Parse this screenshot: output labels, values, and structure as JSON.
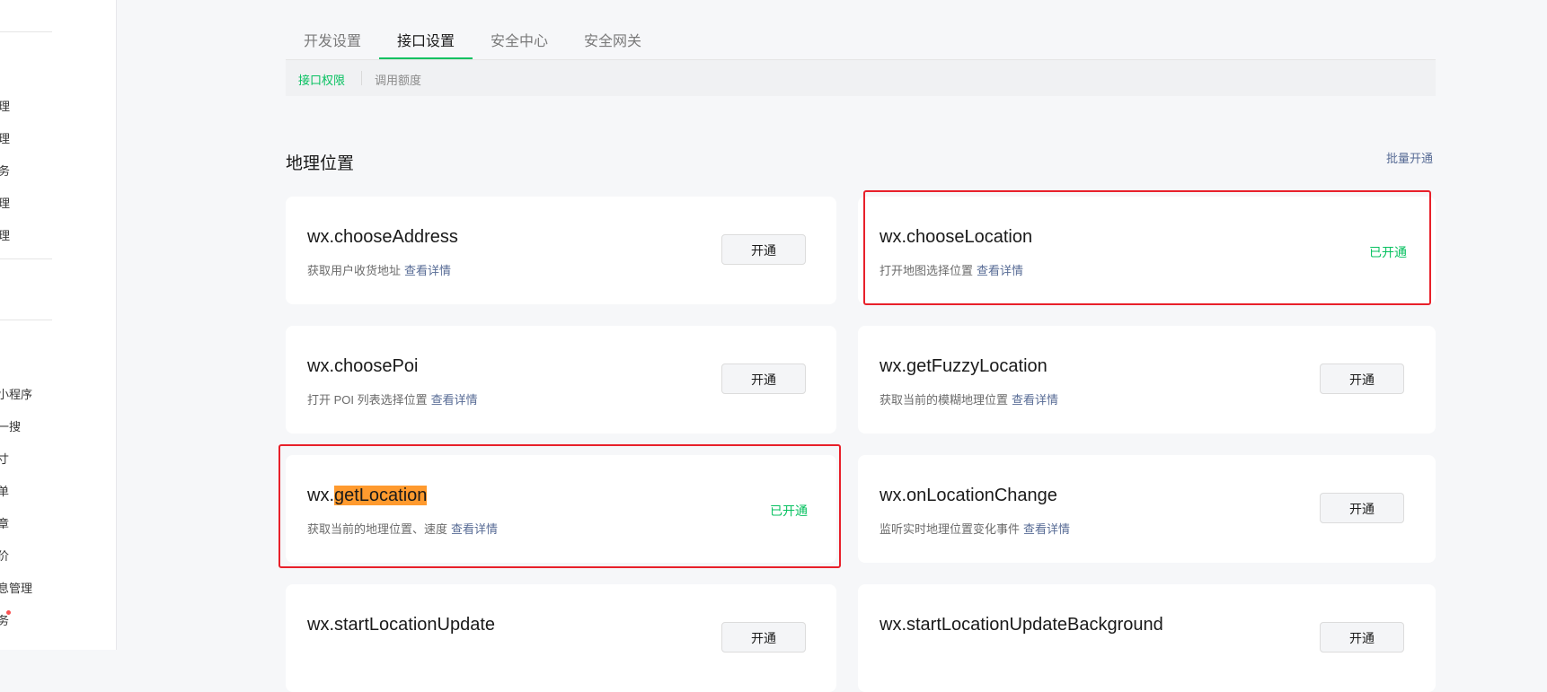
{
  "sidebar": {
    "items": [
      {
        "label": "理"
      },
      {
        "label": "理"
      },
      {
        "label": "务"
      },
      {
        "label": "理"
      },
      {
        "label": "理"
      },
      {
        "label": "小程序"
      },
      {
        "label": "一搜"
      },
      {
        "label": "寸"
      },
      {
        "label": "单"
      },
      {
        "label": "章"
      },
      {
        "label": "价"
      },
      {
        "label": "息管理"
      },
      {
        "label": "务"
      }
    ]
  },
  "tabs": [
    {
      "label": "开发设置"
    },
    {
      "label": "接口设置"
    },
    {
      "label": "安全中心"
    },
    {
      "label": "安全网关"
    }
  ],
  "subtabs": [
    {
      "label": "接口权限"
    },
    {
      "label": "调用额度"
    }
  ],
  "section": {
    "title": "地理位置",
    "batch_label": "批量开通"
  },
  "apis": [
    {
      "prefix": "wx.",
      "name": "chooseAddress",
      "desc": "获取用户收货地址",
      "link": "查看详情",
      "action": "开通"
    },
    {
      "prefix": "wx.",
      "name": "chooseLocation",
      "desc": "打开地图选择位置",
      "link": "查看详情",
      "status": "已开通"
    },
    {
      "prefix": "wx.",
      "name": "choosePoi",
      "desc": "打开 POI 列表选择位置",
      "link": "查看详情",
      "action": "开通"
    },
    {
      "prefix": "wx.",
      "name": "getFuzzyLocation",
      "desc": "获取当前的模糊地理位置",
      "link": "查看详情",
      "action": "开通"
    },
    {
      "prefix": "wx.",
      "name": "getLocation",
      "desc": "获取当前的地理位置、速度",
      "link": "查看详情",
      "status": "已开通"
    },
    {
      "prefix": "wx.",
      "name": "onLocationChange",
      "desc": "监听实时地理位置变化事件",
      "link": "查看详情",
      "action": "开通"
    },
    {
      "prefix": "wx.",
      "name": "startLocationUpdate",
      "action": "开通"
    },
    {
      "prefix": "wx.",
      "name": "startLocationUpdateBackground",
      "action": "开通"
    }
  ],
  "colors": {
    "accent": "#07c160",
    "link": "#576b95",
    "highlight": "#ff9a2e",
    "annotation": "#e8202a",
    "background": "#f6f7f9"
  }
}
